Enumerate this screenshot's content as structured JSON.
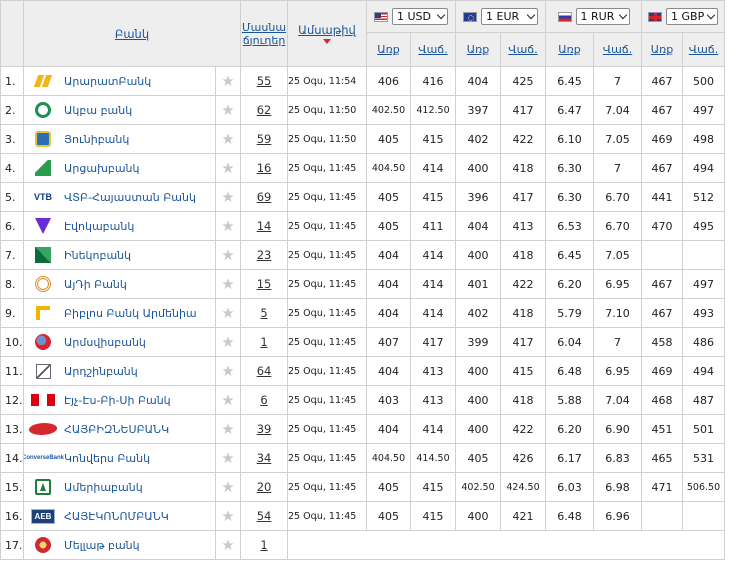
{
  "header": {
    "bank_label": "Բանկ",
    "branches_line1": "Մասնա",
    "branches_line2": "ճյուղեր",
    "date_label": "Ամսաթիվ",
    "buy_label": "Առք",
    "sell_label": "Վաճ.",
    "currencies": [
      {
        "code": "USD",
        "selected": "1 USD",
        "flag": "us-flag-icon"
      },
      {
        "code": "EUR",
        "selected": "1 EUR",
        "flag": "eu-flag-icon"
      },
      {
        "code": "RUR",
        "selected": "1 RUR",
        "flag": "ru-flag-icon"
      },
      {
        "code": "GBP",
        "selected": "1 GBP",
        "flag": "gb-flag-icon"
      }
    ]
  },
  "rows": [
    {
      "n": "1.",
      "name": "ԱրարատԲանկ",
      "branches": "55",
      "date": "25 Օգս, 11:54",
      "usd_buy": "406",
      "usd_sell": "416",
      "eur_buy": "404",
      "eur_sell": "425",
      "rur_buy": "6.45",
      "rur_sell": "7",
      "gbp_buy": "467",
      "gbp_sell": "500"
    },
    {
      "n": "2.",
      "name": "Ակբա բանկ",
      "branches": "62",
      "date": "25 Օգս, 11:50",
      "usd_buy": "402.50",
      "usd_sell": "412.50",
      "eur_buy": "397",
      "eur_sell": "417",
      "rur_buy": "6.47",
      "rur_sell": "7.04",
      "gbp_buy": "467",
      "gbp_sell": "497"
    },
    {
      "n": "3.",
      "name": "Յունիբանկ",
      "branches": "59",
      "date": "25 Օգս, 11:50",
      "usd_buy": "405",
      "usd_sell": "415",
      "eur_buy": "402",
      "eur_sell": "422",
      "rur_buy": "6.10",
      "rur_sell": "7.05",
      "gbp_buy": "469",
      "gbp_sell": "498"
    },
    {
      "n": "4.",
      "name": "Արցախբանկ",
      "branches": "16",
      "date": "25 Օգս, 11:45",
      "usd_buy": "404.50",
      "usd_sell": "414",
      "eur_buy": "400",
      "eur_sell": "418",
      "rur_buy": "6.30",
      "rur_sell": "7",
      "gbp_buy": "467",
      "gbp_sell": "494"
    },
    {
      "n": "5.",
      "name": "ՎՏԲ-Հայաստան Բանկ",
      "branches": "69",
      "date": "25 Օգս, 11:45",
      "usd_buy": "405",
      "usd_sell": "415",
      "eur_buy": "396",
      "eur_sell": "417",
      "rur_buy": "6.30",
      "rur_sell": "6.70",
      "gbp_buy": "441",
      "gbp_sell": "512"
    },
    {
      "n": "6.",
      "name": "Էվոկաբանկ",
      "branches": "14",
      "date": "25 Օգս, 11:45",
      "usd_buy": "405",
      "usd_sell": "411",
      "eur_buy": "404",
      "eur_sell": "413",
      "rur_buy": "6.53",
      "rur_sell": "6.70",
      "gbp_buy": "470",
      "gbp_sell": "495"
    },
    {
      "n": "7.",
      "name": "Ինեկոբանկ",
      "branches": "23",
      "date": "25 Օգս, 11:45",
      "usd_buy": "404",
      "usd_sell": "414",
      "eur_buy": "400",
      "eur_sell": "418",
      "rur_buy": "6.45",
      "rur_sell": "7.05",
      "gbp_buy": "",
      "gbp_sell": ""
    },
    {
      "n": "8.",
      "name": "ԱյԴի Բանկ",
      "branches": "15",
      "date": "25 Օգս, 11:45",
      "usd_buy": "404",
      "usd_sell": "414",
      "eur_buy": "401",
      "eur_sell": "422",
      "rur_buy": "6.20",
      "rur_sell": "6.95",
      "gbp_buy": "467",
      "gbp_sell": "497"
    },
    {
      "n": "9.",
      "name": "Բիբլոս Բանկ Արմենիա",
      "branches": "5",
      "date": "25 Օգս, 11:45",
      "usd_buy": "404",
      "usd_sell": "414",
      "eur_buy": "402",
      "eur_sell": "418",
      "rur_buy": "5.79",
      "rur_sell": "7.10",
      "gbp_buy": "467",
      "gbp_sell": "493"
    },
    {
      "n": "10.",
      "name": "Արմսվիսբանկ",
      "branches": "1",
      "date": "25 Օգս, 11:45",
      "usd_buy": "407",
      "usd_sell": "417",
      "eur_buy": "399",
      "eur_sell": "417",
      "rur_buy": "6.04",
      "rur_sell": "7",
      "gbp_buy": "458",
      "gbp_sell": "486"
    },
    {
      "n": "11.",
      "name": "Արդշինբանկ",
      "branches": "64",
      "date": "25 Օգս, 11:45",
      "usd_buy": "404",
      "usd_sell": "413",
      "eur_buy": "400",
      "eur_sell": "415",
      "rur_buy": "6.48",
      "rur_sell": "6.95",
      "gbp_buy": "469",
      "gbp_sell": "494"
    },
    {
      "n": "12.",
      "name": "Էյչ-Էս-Բի-Սի Բանկ",
      "branches": "6",
      "date": "25 Օգս, 11:45",
      "usd_buy": "403",
      "usd_sell": "413",
      "eur_buy": "400",
      "eur_sell": "418",
      "rur_buy": "5.88",
      "rur_sell": "7.04",
      "gbp_buy": "468",
      "gbp_sell": "487"
    },
    {
      "n": "13.",
      "name": "ՀԱՅԲԻԶՆԵՍԲԱՆԿ",
      "branches": "39",
      "date": "25 Օգս, 11:45",
      "usd_buy": "404",
      "usd_sell": "414",
      "eur_buy": "400",
      "eur_sell": "422",
      "rur_buy": "6.20",
      "rur_sell": "6.90",
      "gbp_buy": "451",
      "gbp_sell": "501"
    },
    {
      "n": "14.",
      "name": "Կոնվերս Բանկ",
      "branches": "34",
      "date": "25 Օգս, 11:45",
      "usd_buy": "404.50",
      "usd_sell": "414.50",
      "eur_buy": "405",
      "eur_sell": "426",
      "rur_buy": "6.17",
      "rur_sell": "6.83",
      "gbp_buy": "465",
      "gbp_sell": "531"
    },
    {
      "n": "15.",
      "name": "Ամերիաբանկ",
      "branches": "20",
      "date": "25 Օգս, 11:45",
      "usd_buy": "405",
      "usd_sell": "415",
      "eur_buy": "402.50",
      "eur_sell": "424.50",
      "rur_buy": "6.03",
      "rur_sell": "6.98",
      "gbp_buy": "471",
      "gbp_sell": "506.50"
    },
    {
      "n": "16.",
      "name": "ՀԱՅԷԿՈՆՈՄԲԱՆԿ",
      "branches": "54",
      "date": "25 Օգս, 11:45",
      "usd_buy": "405",
      "usd_sell": "415",
      "eur_buy": "400",
      "eur_sell": "421",
      "rur_buy": "6.48",
      "rur_sell": "6.96",
      "gbp_buy": "",
      "gbp_sell": ""
    },
    {
      "n": "17.",
      "name": "Մելլաթ բանկ",
      "branches": "1",
      "date": "",
      "usd_buy": "",
      "usd_sell": "",
      "eur_buy": "",
      "eur_sell": "",
      "rur_buy": "",
      "rur_sell": "",
      "gbp_buy": "",
      "gbp_sell": ""
    }
  ],
  "logos": [
    "ararat-logo-icon",
    "acba-logo-icon",
    "unibank-logo-icon",
    "artsakh-logo-icon",
    "vtb-logo-icon",
    "evoca-logo-icon",
    "ineco-logo-icon",
    "idbank-logo-icon",
    "byblos-logo-icon",
    "armswiss-logo-icon",
    "ardshin-logo-icon",
    "hsbc-logo-icon",
    "haybusiness-logo-icon",
    "converse-logo-icon",
    "ameria-logo-icon",
    "aeb-logo-icon",
    "mellat-logo-icon"
  ],
  "logo_text": {
    "vtb": "VTB",
    "converse": "ConverseBank",
    "aeb": "AEB"
  },
  "colors": {
    "link": "#1a5599",
    "header_bg": "#eeeeee",
    "sort_arrow": "#d9262b",
    "star": "#c9c9c9"
  }
}
